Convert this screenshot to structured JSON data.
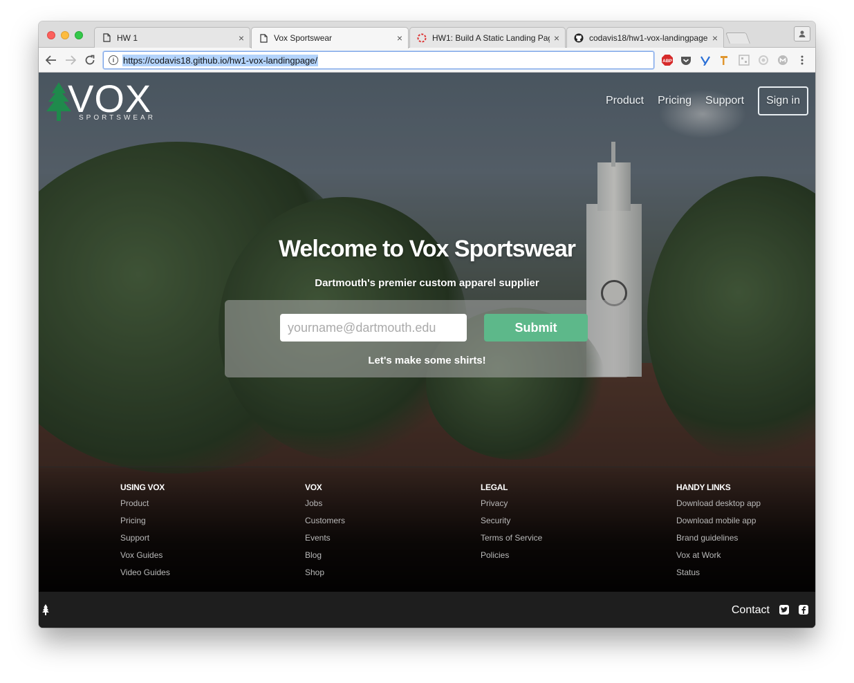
{
  "browser": {
    "tabs": [
      {
        "title": "HW 1",
        "icon": "page-icon"
      },
      {
        "title": "Vox Sportswear",
        "icon": "page-icon"
      },
      {
        "title": "HW1: Build A Static Landing Page",
        "icon": "lifebuoy-icon"
      },
      {
        "title": "codavis18/hw1-vox-landingpage",
        "icon": "github-icon"
      }
    ],
    "close_glyph": "×",
    "url": "https://codavis18.github.io/hw1-vox-landingpage/",
    "extensions": [
      "abp-icon",
      "pocket-icon",
      "yoast-icon",
      "hammer-icon",
      "qr-icon",
      "circle-icon",
      "m-icon"
    ],
    "abp_label": "ABP"
  },
  "header": {
    "logo_text": "VOX",
    "logo_sub": "SPORTSWEAR",
    "nav": [
      "Product",
      "Pricing",
      "Support"
    ],
    "signin": "Sign in"
  },
  "hero": {
    "title": "Welcome to Vox Sportswear",
    "subtitle": "Dartmouth's premier custom apparel supplier",
    "email_placeholder": "yourname@dartmouth.edu",
    "submit": "Submit",
    "tagline": "Let's make some shirts!"
  },
  "footer": {
    "columns": [
      {
        "heading": "USING VOX",
        "items": [
          "Product",
          "Pricing",
          "Support",
          "Vox Guides",
          "Video Guides"
        ]
      },
      {
        "heading": "VOX",
        "items": [
          "Jobs",
          "Customers",
          "Events",
          "Blog",
          "Shop"
        ]
      },
      {
        "heading": "LEGAL",
        "items": [
          "Privacy",
          "Security",
          "Terms of Service",
          "Policies"
        ]
      },
      {
        "heading": "HANDY LINKS",
        "items": [
          "Download desktop app",
          "Download mobile app",
          "Brand guidelines",
          "Vox at Work",
          "Status"
        ]
      }
    ],
    "contact": "Contact"
  },
  "colors": {
    "accent_green": "#5db88a",
    "logo_green": "#1f8a4c",
    "bottom_bar": "#1e1e1e",
    "url_highlight": "#b3d3fb"
  }
}
